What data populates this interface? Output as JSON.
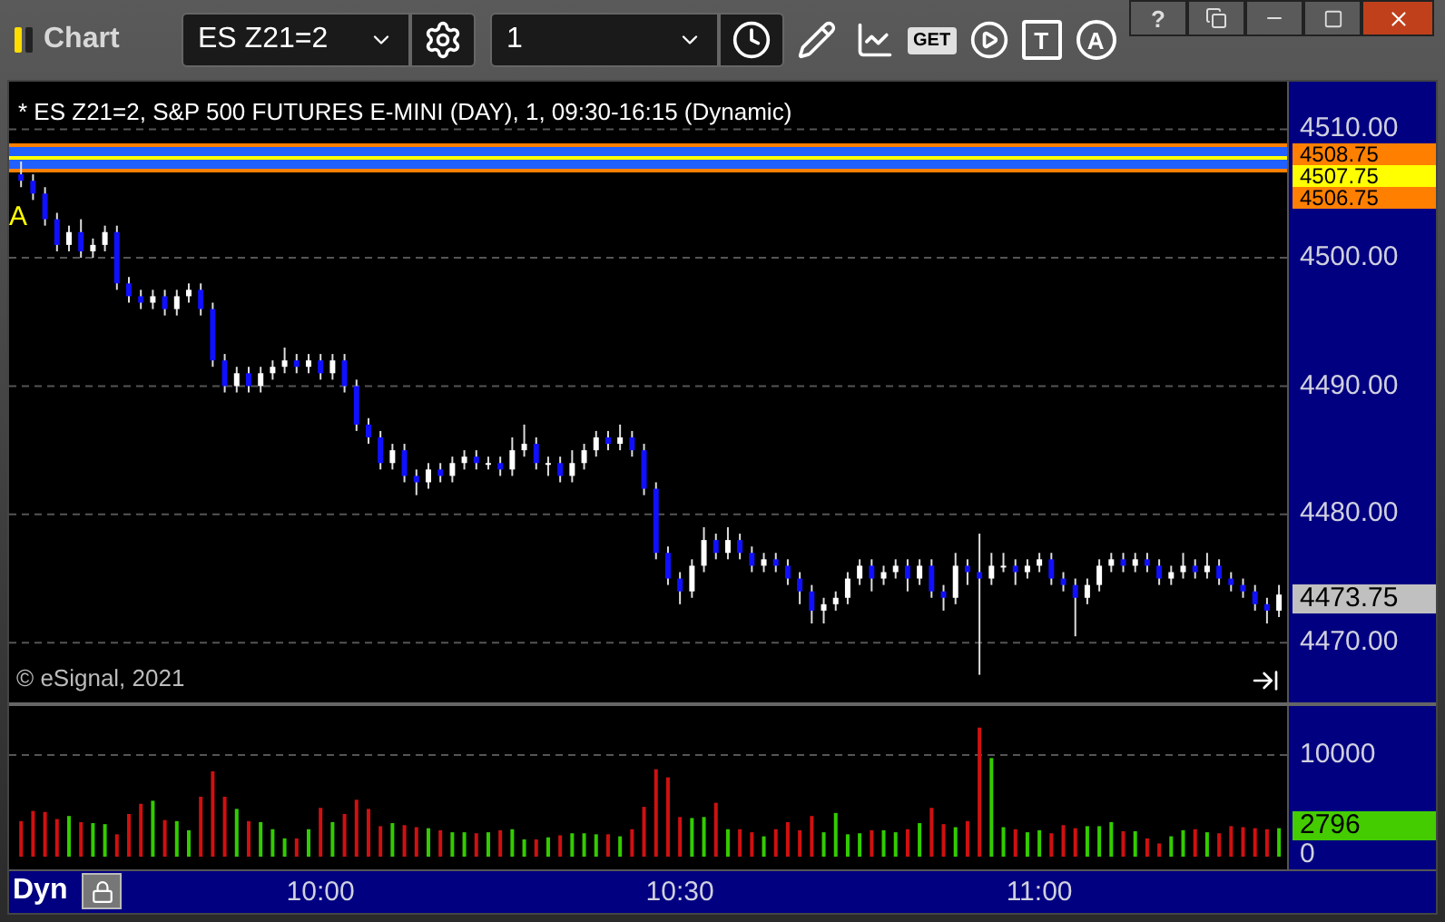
{
  "window": {
    "title": "Chart",
    "help_label": "?"
  },
  "toolbar": {
    "symbol": "ES Z21=2",
    "interval": "1",
    "get_label": "GET",
    "text_tool_label": "T",
    "alert_tool_label": "A"
  },
  "chart": {
    "caption": "* ES Z21=2, S&P 500 FUTURES E-MINI (DAY), 1, 09:30-16:15 (Dynamic)",
    "marker": "A",
    "copyright": "© eSignal, 2021",
    "chart_data": {
      "type": "candlestick",
      "xlim": [
        574,
        693.1
      ],
      "ylim": [
        4465.35,
        4513.72
      ],
      "grid": true,
      "x": [
        575,
        576,
        577,
        578,
        579,
        580,
        581,
        582,
        583,
        584,
        585,
        586,
        587,
        588,
        589,
        590,
        591,
        592,
        593,
        594,
        595,
        596,
        597,
        598,
        599,
        600,
        601,
        602,
        603,
        604,
        605,
        606,
        607,
        608,
        609,
        610,
        611,
        612,
        613,
        614,
        615,
        616,
        617,
        618,
        619,
        620,
        621,
        622,
        623,
        624,
        625,
        626,
        627,
        628,
        629,
        630,
        631,
        632,
        633,
        634,
        635,
        636,
        637,
        638,
        639,
        640,
        641,
        642,
        643,
        644,
        645,
        646,
        647,
        648,
        649,
        650,
        651,
        652,
        653,
        654,
        655,
        656,
        657,
        658,
        659,
        660,
        661,
        662,
        663,
        664,
        665,
        666,
        667,
        668,
        669,
        670,
        671,
        672,
        673,
        674,
        675,
        676,
        677,
        678,
        679,
        680
      ],
      "ohlc": [
        [
          4506.5,
          4507.5,
          4505.5,
          4506
        ],
        [
          4506,
          4506.5,
          4504.5,
          4505
        ],
        [
          4505,
          4505.5,
          4502.5,
          4503
        ],
        [
          4503,
          4503.5,
          4500.5,
          4501
        ],
        [
          4501,
          4502.5,
          4500.5,
          4502
        ],
        [
          4502,
          4503,
          4500,
          4500.5
        ],
        [
          4500.5,
          4501.5,
          4500,
          4501
        ],
        [
          4501,
          4502.5,
          4500.5,
          4502
        ],
        [
          4502,
          4502.5,
          4497.5,
          4498
        ],
        [
          4498,
          4498.5,
          4496.5,
          4497
        ],
        [
          4497,
          4497.5,
          4496,
          4496.5
        ],
        [
          4496.5,
          4497.5,
          4496,
          4497
        ],
        [
          4497,
          4497.5,
          4495.5,
          4496
        ],
        [
          4496,
          4497.5,
          4495.5,
          4497
        ],
        [
          4497,
          4498,
          4496.5,
          4497.5
        ],
        [
          4497.5,
          4498,
          4495.5,
          4496
        ],
        [
          4496,
          4496.5,
          4491.5,
          4492
        ],
        [
          4492,
          4492.5,
          4489.5,
          4490
        ],
        [
          4490,
          4491.5,
          4489.5,
          4491
        ],
        [
          4491,
          4491.5,
          4489.5,
          4490
        ],
        [
          4490,
          4491.5,
          4489.5,
          4491
        ],
        [
          4491,
          4492,
          4490.5,
          4491.5
        ],
        [
          4491.5,
          4493,
          4491,
          4492
        ],
        [
          4492,
          4492.5,
          4491,
          4491.5
        ],
        [
          4491.5,
          4492.5,
          4491,
          4492
        ],
        [
          4492,
          4492.5,
          4490.5,
          4491
        ],
        [
          4491,
          4492.5,
          4490.5,
          4492
        ],
        [
          4492,
          4492.5,
          4489.5,
          4490
        ],
        [
          4490,
          4490.5,
          4486.5,
          4487
        ],
        [
          4487,
          4487.5,
          4485.5,
          4486
        ],
        [
          4486,
          4486.5,
          4483.5,
          4484
        ],
        [
          4484,
          4485.5,
          4483.5,
          4485
        ],
        [
          4485,
          4485.5,
          4482.5,
          4483
        ],
        [
          4483,
          4483.5,
          4481.5,
          4482.5
        ],
        [
          4482.5,
          4484,
          4482,
          4483.5
        ],
        [
          4483.5,
          4484,
          4482.5,
          4483
        ],
        [
          4483,
          4484.5,
          4482.5,
          4484
        ],
        [
          4484,
          4485,
          4483.5,
          4484.5
        ],
        [
          4484.5,
          4485,
          4483.5,
          4484
        ],
        [
          4484,
          4484.5,
          4483.5,
          4484
        ],
        [
          4484,
          4484.5,
          4483,
          4483.5
        ],
        [
          4483.5,
          4486,
          4483,
          4485
        ],
        [
          4485,
          4487,
          4484.5,
          4485.5
        ],
        [
          4485.5,
          4486,
          4483.5,
          4484
        ],
        [
          4484,
          4484.5,
          4483,
          4484
        ],
        [
          4484,
          4484.5,
          4482.5,
          4483
        ],
        [
          4483,
          4485,
          4482.5,
          4484
        ],
        [
          4484,
          4485.5,
          4483.5,
          4485
        ],
        [
          4485,
          4486.5,
          4484.5,
          4486
        ],
        [
          4486,
          4486.5,
          4485,
          4485.5
        ],
        [
          4485.5,
          4487,
          4485,
          4486
        ],
        [
          4486,
          4486.5,
          4484.5,
          4485
        ],
        [
          4485,
          4485.5,
          4481.5,
          4482
        ],
        [
          4482,
          4482.5,
          4476.5,
          4477
        ],
        [
          4477,
          4477.5,
          4474.5,
          4475
        ],
        [
          4475,
          4475.5,
          4473,
          4474
        ],
        [
          4474,
          4476.5,
          4473.5,
          4476
        ],
        [
          4476,
          4479,
          4475.5,
          4478
        ],
        [
          4478,
          4478.5,
          4476.5,
          4477
        ],
        [
          4477,
          4479,
          4476.5,
          4478
        ],
        [
          4478,
          4478.5,
          4476.5,
          4477
        ],
        [
          4477,
          4477.5,
          4475.5,
          4476
        ],
        [
          4476,
          4477,
          4475.5,
          4476.5
        ],
        [
          4476.5,
          4477,
          4475.5,
          4476
        ],
        [
          4476,
          4476.5,
          4474.5,
          4475
        ],
        [
          4475,
          4475.5,
          4473,
          4474
        ],
        [
          4474,
          4474.5,
          4471.5,
          4472.5
        ],
        [
          4472.5,
          4473.5,
          4471.5,
          4473
        ],
        [
          4473,
          4474,
          4472.5,
          4473.5
        ],
        [
          4473.5,
          4475.5,
          4473,
          4475
        ],
        [
          4475,
          4476.5,
          4474.5,
          4476
        ],
        [
          4476,
          4476.5,
          4474,
          4475
        ],
        [
          4475,
          4476,
          4474.5,
          4475.5
        ],
        [
          4475.5,
          4476.5,
          4475,
          4476
        ],
        [
          4476,
          4476.5,
          4474,
          4475
        ],
        [
          4475,
          4476.5,
          4474.5,
          4476
        ],
        [
          4476,
          4476.5,
          4473.5,
          4474
        ],
        [
          4474,
          4474.5,
          4472.5,
          4473.5
        ],
        [
          4473.5,
          4477,
          4473,
          4476
        ],
        [
          4476,
          4476.5,
          4474.5,
          4475.5
        ],
        [
          4475.5,
          4478.5,
          4467.5,
          4475
        ],
        [
          4475,
          4477,
          4474.5,
          4476
        ],
        [
          4476,
          4477,
          4475.5,
          4476
        ],
        [
          4476,
          4476.5,
          4474.5,
          4475.5
        ],
        [
          4475.5,
          4476.5,
          4475,
          4476
        ],
        [
          4476,
          4477,
          4475.5,
          4476.5
        ],
        [
          4476.5,
          4477,
          4474.5,
          4475
        ],
        [
          4475,
          4475.5,
          4474,
          4474.5
        ],
        [
          4474.5,
          4475,
          4470.5,
          4473.5
        ],
        [
          4473.5,
          4475,
          4473,
          4474.5
        ],
        [
          4474.5,
          4476.5,
          4474,
          4476
        ],
        [
          4476,
          4477,
          4475.5,
          4476.5
        ],
        [
          4476.5,
          4477,
          4475.5,
          4476
        ],
        [
          4476,
          4477,
          4475.5,
          4476.5
        ],
        [
          4476.5,
          4477,
          4475.5,
          4476
        ],
        [
          4476,
          4476.5,
          4474.5,
          4475
        ],
        [
          4475,
          4476,
          4474.5,
          4475.5
        ],
        [
          4475.5,
          4477,
          4475,
          4476
        ],
        [
          4476,
          4476.5,
          4475,
          4475.5
        ],
        [
          4475.5,
          4477,
          4475,
          4476
        ],
        [
          4476,
          4476.5,
          4474.5,
          4475
        ],
        [
          4475,
          4475.5,
          4474,
          4474.5
        ],
        [
          4474.5,
          4475,
          4473.5,
          4474
        ],
        [
          4474,
          4474.5,
          4472.5,
          4473
        ],
        [
          4473,
          4473.5,
          4471.5,
          4472.5
        ],
        [
          4472.5,
          4474.5,
          4472,
          4473.75
        ]
      ],
      "yticks": [
        {
          "value": 4510,
          "label": "4510.00"
        },
        {
          "value": 4500,
          "label": "4500.00"
        },
        {
          "value": 4490,
          "label": "4490.00"
        },
        {
          "value": 4480,
          "label": "4480.00"
        },
        {
          "value": 4470,
          "label": "4470.00"
        }
      ]
    },
    "levels": [
      {
        "text": "4508.75",
        "color": "#ff8000"
      },
      {
        "text": "4507.75",
        "color": "#ffff00"
      },
      {
        "text": "4506.75",
        "color": "#ff8000"
      }
    ],
    "last_price": {
      "text": "4473.75",
      "color": "#c0c0c0"
    },
    "volume": {
      "chart_data": {
        "type": "bar",
        "xlim": [
          574,
          693.1
        ],
        "ylim": [
          0,
          14821
        ],
        "yticks": [
          {
            "value": 10000,
            "label": "10000"
          },
          {
            "value": 0,
            "label": "0"
          }
        ],
        "xticks": [
          {
            "value": 600,
            "label": "10:00"
          },
          {
            "value": 630,
            "label": "10:30"
          },
          {
            "value": 660,
            "label": "11:00"
          }
        ],
        "x": [
          575,
          576,
          577,
          578,
          579,
          580,
          581,
          582,
          583,
          584,
          585,
          586,
          587,
          588,
          589,
          590,
          591,
          592,
          593,
          594,
          595,
          596,
          597,
          598,
          599,
          600,
          601,
          602,
          603,
          604,
          605,
          606,
          607,
          608,
          609,
          610,
          611,
          612,
          613,
          614,
          615,
          616,
          617,
          618,
          619,
          620,
          621,
          622,
          623,
          624,
          625,
          626,
          627,
          628,
          629,
          630,
          631,
          632,
          633,
          634,
          635,
          636,
          637,
          638,
          639,
          640,
          641,
          642,
          643,
          644,
          645,
          646,
          647,
          648,
          649,
          650,
          651,
          652,
          653,
          654,
          655,
          656,
          657,
          658,
          659,
          660,
          661,
          662,
          663,
          664,
          665,
          666,
          667,
          668,
          669,
          670,
          671,
          672,
          673,
          674,
          675,
          676,
          677,
          678,
          679,
          680
        ],
        "values": [
          3500,
          4500,
          4400,
          3700,
          4000,
          3400,
          3300,
          3200,
          2200,
          4200,
          5200,
          5500,
          3600,
          3500,
          2600,
          5900,
          8400,
          5900,
          4700,
          3500,
          3400,
          2700,
          1800,
          1800,
          2700,
          4800,
          3400,
          4200,
          5600,
          4700,
          3000,
          3300,
          3100,
          2900,
          2800,
          2600,
          2400,
          2400,
          2300,
          2400,
          2600,
          2700,
          1700,
          1700,
          1900,
          2100,
          2300,
          2300,
          2200,
          2200,
          2000,
          2700,
          4900,
          8600,
          7800,
          3900,
          3800,
          3900,
          5300,
          2700,
          2700,
          2400,
          2000,
          2700,
          3400,
          2600,
          4000,
          2400,
          4300,
          2200,
          2300,
          2600,
          2600,
          2400,
          2700,
          3300,
          4800,
          3200,
          2900,
          3500,
          12700,
          9700,
          2900,
          2700,
          2400,
          2600,
          2300,
          3100,
          2800,
          3000,
          3000,
          3400,
          2500,
          2500,
          1800,
          1300,
          2000,
          2600,
          2700,
          2400,
          2300,
          3000,
          2900,
          2800,
          2700,
          2800
        ]
      },
      "label": "2796"
    },
    "mode": "Dyn"
  }
}
